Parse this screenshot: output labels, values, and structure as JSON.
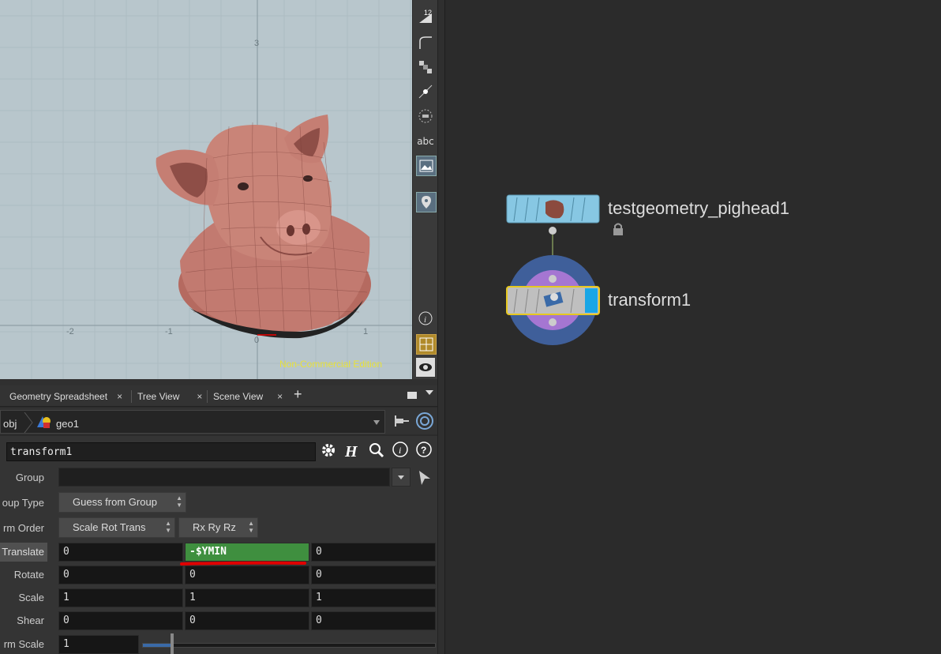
{
  "viewport": {
    "watermark": "Non-Commercial Edition",
    "axis_labels": [
      "-2",
      "-1",
      "0",
      "1",
      "3"
    ]
  },
  "viewport_toolbar": {
    "items": [
      "12",
      "abc"
    ]
  },
  "tabs": [
    {
      "label": "Geometry Spreadsheet"
    },
    {
      "label": "Tree View"
    },
    {
      "label": "Scene View"
    }
  ],
  "tab_close": "×",
  "tab_add": "+",
  "path": {
    "root": "obj",
    "node": "geo1"
  },
  "params": {
    "node_name": "transform1",
    "group_label": "Group",
    "group_value": "",
    "group_type_label": "oup Type",
    "group_type_value": "Guess from Group",
    "xform_order_label": "rm Order",
    "xform_order_value": "Scale Rot Trans",
    "rot_order_value": "Rx Ry Rz",
    "translate_label": "Translate",
    "translate": [
      "0",
      "-$YMIN",
      "0"
    ],
    "rotate_label": "Rotate",
    "rotate": [
      "0",
      "0",
      "0"
    ],
    "scale_label": "Scale",
    "scale": [
      "1",
      "1",
      "1"
    ],
    "shear_label": "Shear",
    "shear": [
      "0",
      "0",
      "0"
    ],
    "uniform_scale_label": "rm Scale",
    "uniform_scale": "1",
    "uniform_scale_slider": 0.0
  },
  "network": {
    "nodes": [
      {
        "name": "testgeometry_pighead1",
        "locked": true
      },
      {
        "name": "transform1",
        "selected": true
      }
    ]
  },
  "colors": {
    "expression_field": "#3f8f3f",
    "annotation_underline": "#e00000",
    "node_selected_border": "#e6c820",
    "display_flag": "#19a6e6",
    "watermark": "#e8e23a"
  }
}
